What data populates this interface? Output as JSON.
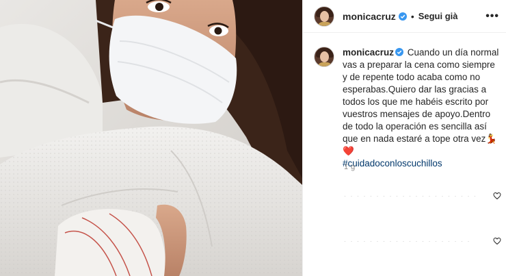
{
  "post": {
    "username": "monicacruz",
    "separator": "•",
    "follow_status": "Segui già",
    "more_label": "•••"
  },
  "caption": {
    "username": "monicacruz",
    "text": "Cuando un día normal vas a preparar la cena como siempre y de repente todo acaba como no esperabas.Quiero dar las gracias a todos los que me habéis escrito por vuestros mensajes de apoyo.Dentro de todo la operación es sencilla así que en nada estaré a tope otra vez",
    "emoji_1": "💃",
    "emoji_2": "❤️",
    "hashtag": "#cuidadoconloscuchillos",
    "time": "1 g"
  },
  "comments": [
    {
      "text": "· · · · · · · · · · · · · · · · · · · · ·"
    },
    {
      "text": "· · · · · · · · · · · · · · · · · · · ·"
    }
  ],
  "icons": {
    "verified": "verified-badge-icon",
    "more": "more-options-icon",
    "like": "heart-outline-icon"
  },
  "colors": {
    "verified": "#3897f0",
    "hashtag": "#00376b",
    "muted": "#8e8e8e",
    "heart": "#ed4956"
  }
}
